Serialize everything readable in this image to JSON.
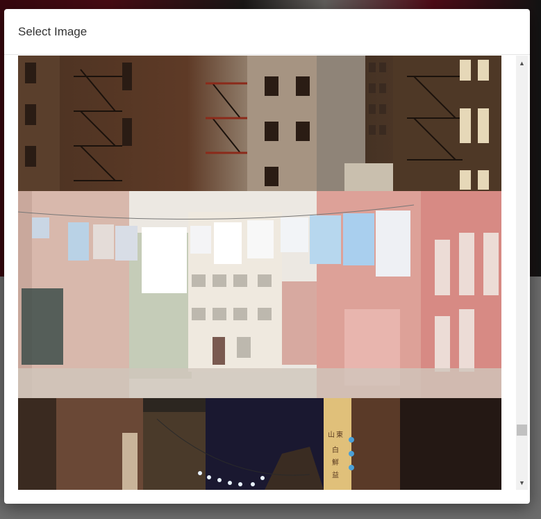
{
  "modal": {
    "title": "Select Image"
  },
  "images": [
    {
      "name": "fire-escape-buildings"
    },
    {
      "name": "laundry-alley"
    },
    {
      "name": "night-alley-lanterns"
    }
  ],
  "scrollbar": {
    "up_icon": "▲",
    "down_icon": "▼"
  }
}
